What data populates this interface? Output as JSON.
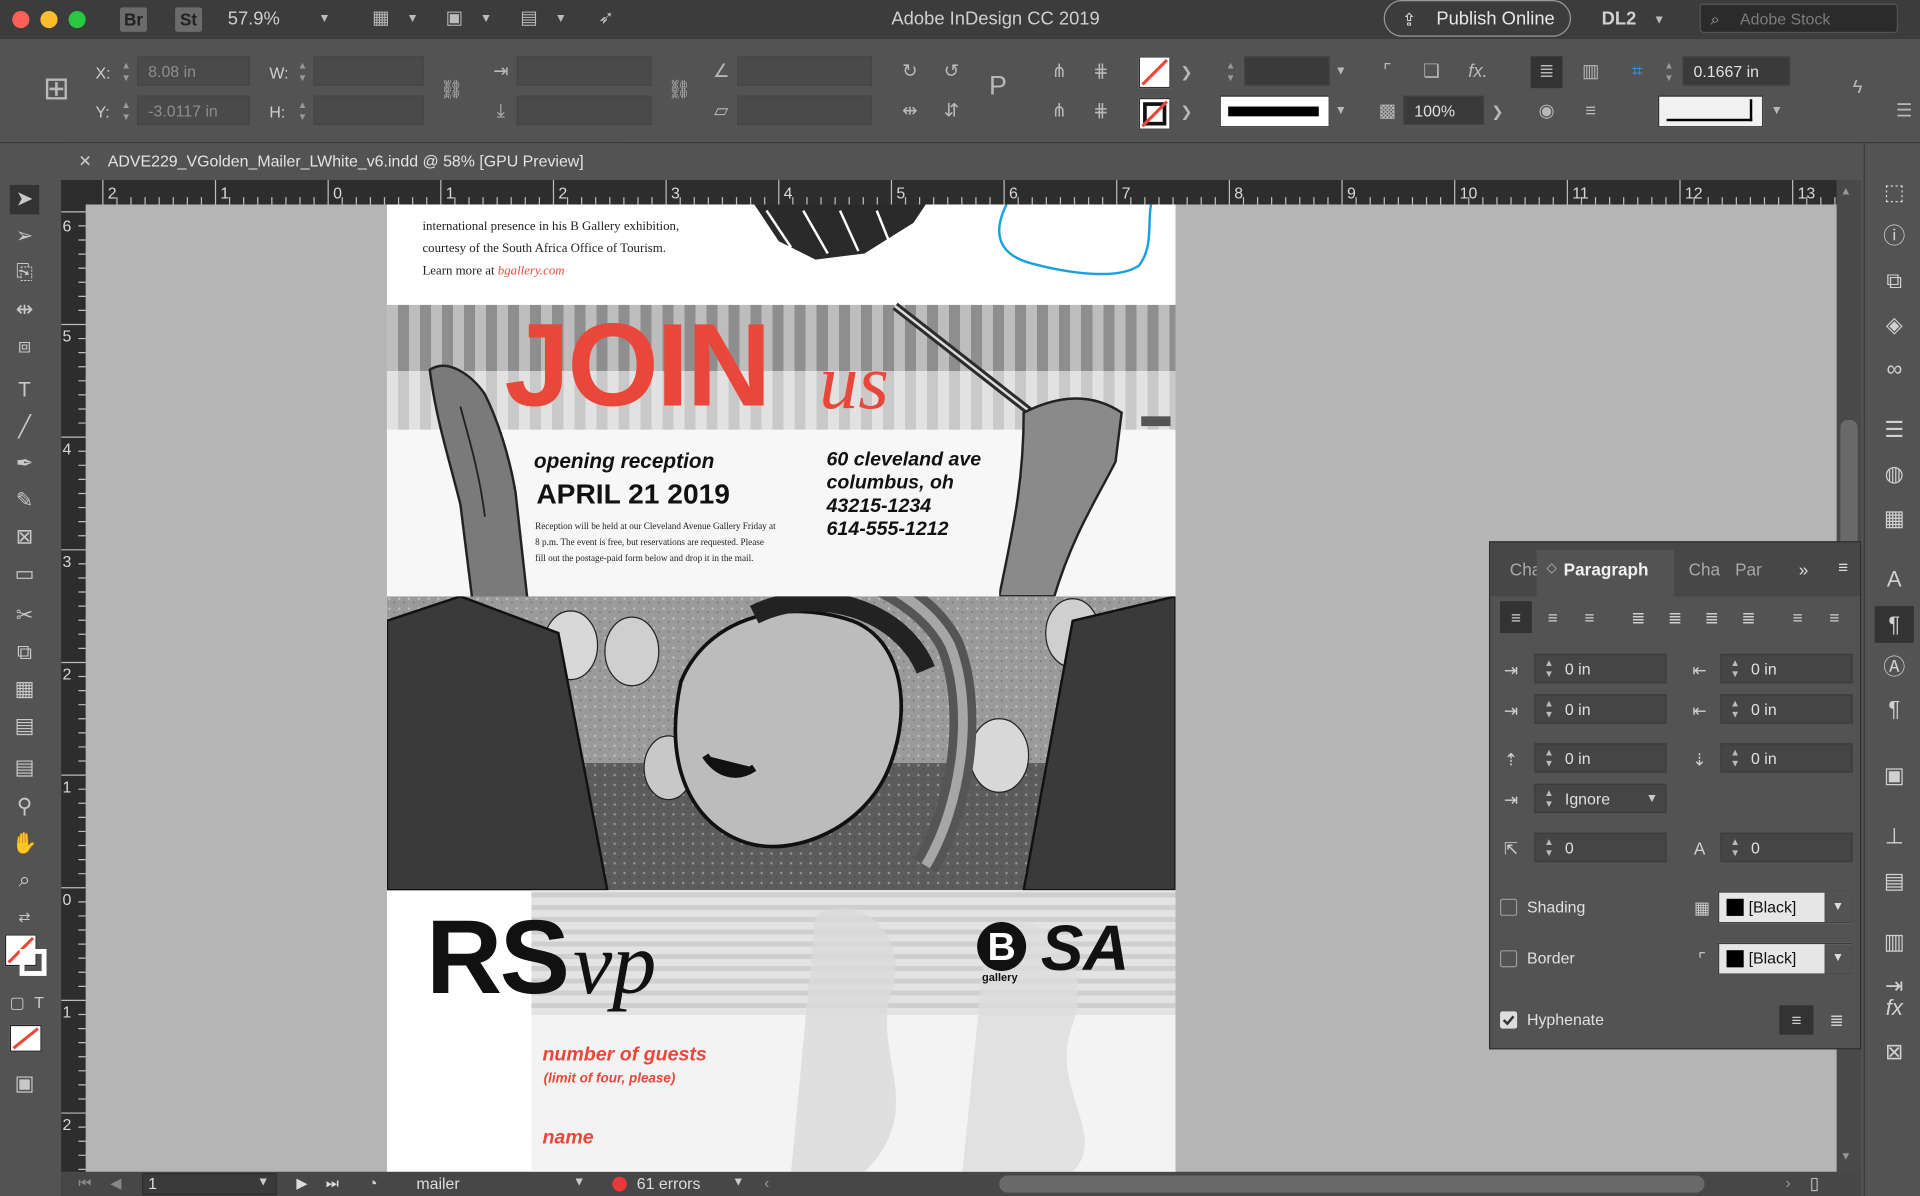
{
  "window": {
    "title": "Adobe InDesign CC 2019"
  },
  "titlebar": {
    "bridge_badge": "Br",
    "stock_badge": "St",
    "zoom": "57.9%",
    "publish_label": "Publish Online",
    "workspace": "DL2",
    "stock_placeholder": "Adobe Stock"
  },
  "control": {
    "x_label": "X:",
    "x_value": "8.08 in",
    "y_label": "Y:",
    "y_value": "-3.0117 in",
    "w_label": "W:",
    "h_label": "H:",
    "stroke_opacity": "100%",
    "stroke_weight": "0.1667 in"
  },
  "document": {
    "tab_title": "ADVE229_VGolden_Mailer_LWhite_v6.indd @ 58% [GPU Preview]"
  },
  "ruler": {
    "h_ticks": [
      "2",
      "1",
      "0",
      "1",
      "2",
      "3",
      "4",
      "5",
      "6",
      "7",
      "8",
      "9",
      "10",
      "11",
      "12",
      "13"
    ],
    "v_ticks": [
      "6",
      "5",
      "4",
      "3",
      "2",
      "1",
      "0",
      "1",
      "2"
    ]
  },
  "artwork": {
    "intro_line1": "international presence in his B Gallery exhibition,",
    "intro_line2": "courtesy of the South Africa Office of Tourism.",
    "intro_line3": "Learn more at ",
    "intro_link": "bgallery.com",
    "join": "JOIN",
    "us": "us",
    "opening": "opening reception",
    "date": "APRIL 21 2019",
    "body1": "Reception will be held at our Cleveland Avenue Gallery Friday at",
    "body2": "8 p.m. The event is free, but reservations are requested. Please",
    "body3": "fill out the postage-paid form below and drop it in the mail.",
    "addr1": "60 cleveland ave",
    "addr2": "columbus, oh",
    "addr3": "43215-1234",
    "addr4": "614-555-1212",
    "rs": "RS",
    "vp": "vp",
    "logo_b": "B",
    "logo_gallery": "gallery",
    "logo_sa": "SA",
    "guests": "number of guests",
    "guests_note": "(limit of four, please)",
    "name": "name"
  },
  "paragraph_panel": {
    "tab_char": "Cha",
    "tab_para": "Paragraph",
    "tab_char2": "Cha",
    "tab_par2": "Par",
    "left_indent": "0 in",
    "right_indent": "0 in",
    "first_indent": "0 in",
    "last_indent": "0 in",
    "space_before": "0 in",
    "space_after": "0 in",
    "align_grid": "Ignore",
    "dropcap_lines": "0",
    "dropcap_chars": "0",
    "shading_label": "Shading",
    "shading_color": "[Black]",
    "border_label": "Border",
    "border_color": "[Black]",
    "hyphenate_label": "Hyphenate"
  },
  "status": {
    "page": "1",
    "preflight_profile": "mailer",
    "errors": "61 errors"
  },
  "colors": {
    "accent_red": "#e8473a",
    "blue_path": "#1aa0e0",
    "ui_bg": "#535353"
  }
}
